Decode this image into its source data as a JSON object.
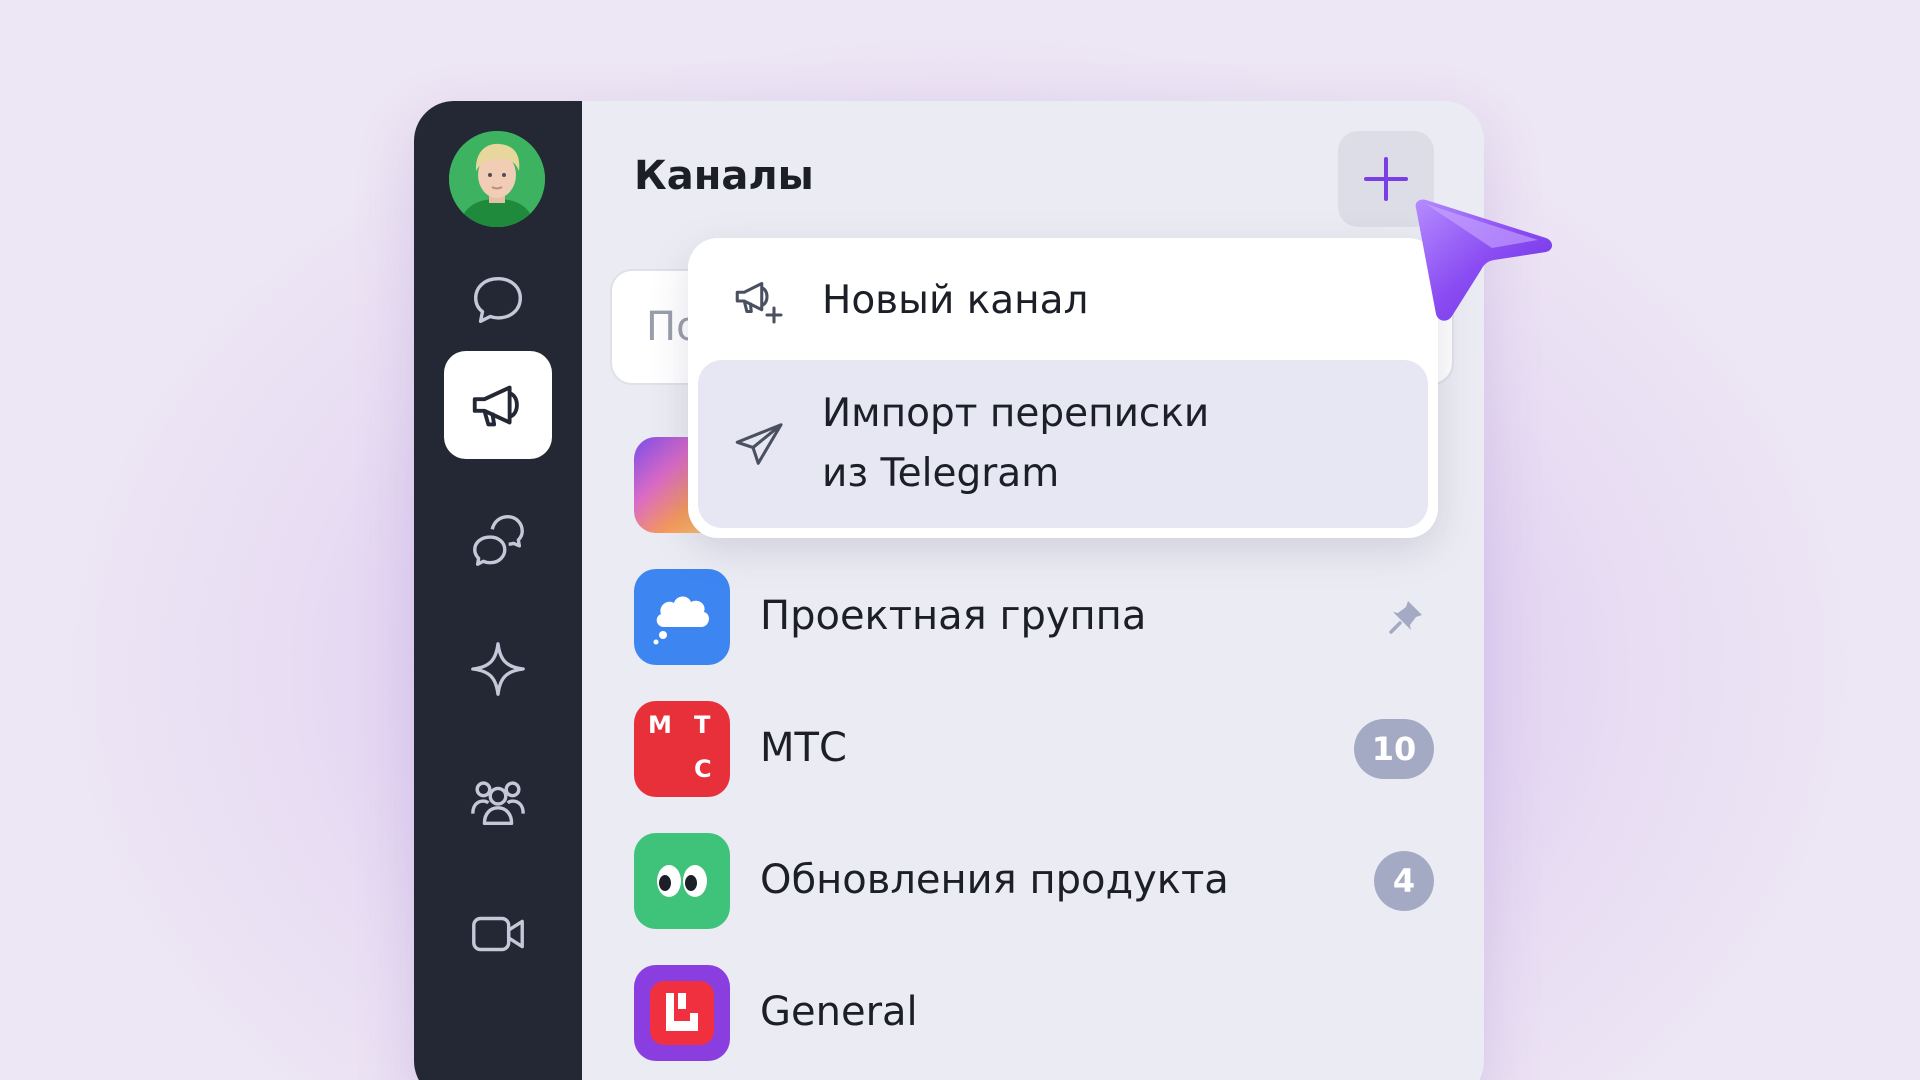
{
  "app": {
    "accent_color": "#7a3ee6",
    "sidebar": {
      "avatar_alt": "user-avatar",
      "items": [
        {
          "name": "chats",
          "icon": "chat-bubble-icon",
          "active": false
        },
        {
          "name": "channels",
          "icon": "megaphone-icon",
          "active": true
        },
        {
          "name": "threads",
          "icon": "threads-icon",
          "active": false
        },
        {
          "name": "ai",
          "icon": "sparkle-icon",
          "active": false
        },
        {
          "name": "contacts",
          "icon": "people-icon",
          "active": false
        },
        {
          "name": "calls",
          "icon": "video-camera-icon",
          "active": false
        }
      ]
    },
    "header": {
      "title": "Каналы",
      "add_icon": "plus-icon"
    },
    "search": {
      "placeholder": "Поиск"
    },
    "dropdown": {
      "items": [
        {
          "label": "Новый канал",
          "icon": "megaphone-plus-icon"
        },
        {
          "label": "Импорт переписки\nиз Telegram",
          "icon": "telegram-plane-icon",
          "hovered": true
        }
      ]
    },
    "channels": [
      {
        "name": "",
        "icon": "gradient-avatar",
        "color": "#f07a4a"
      },
      {
        "name": "Проектная группа",
        "icon": "thought-cloud-icon",
        "color": "#3d86f2",
        "pinned": true,
        "pin_icon": "pin-icon"
      },
      {
        "name": "МТС",
        "icon": "mts-logo",
        "color": "#e8303a",
        "logo_letters": [
          "М",
          "Т",
          "С"
        ],
        "badge": "10"
      },
      {
        "name": "Обновления продукта",
        "icon": "eyes-icon",
        "color": "#3fc27a",
        "badge": "4"
      },
      {
        "name": "General",
        "icon": "app-logo-icon",
        "color": "#8a3ee0"
      }
    ]
  }
}
